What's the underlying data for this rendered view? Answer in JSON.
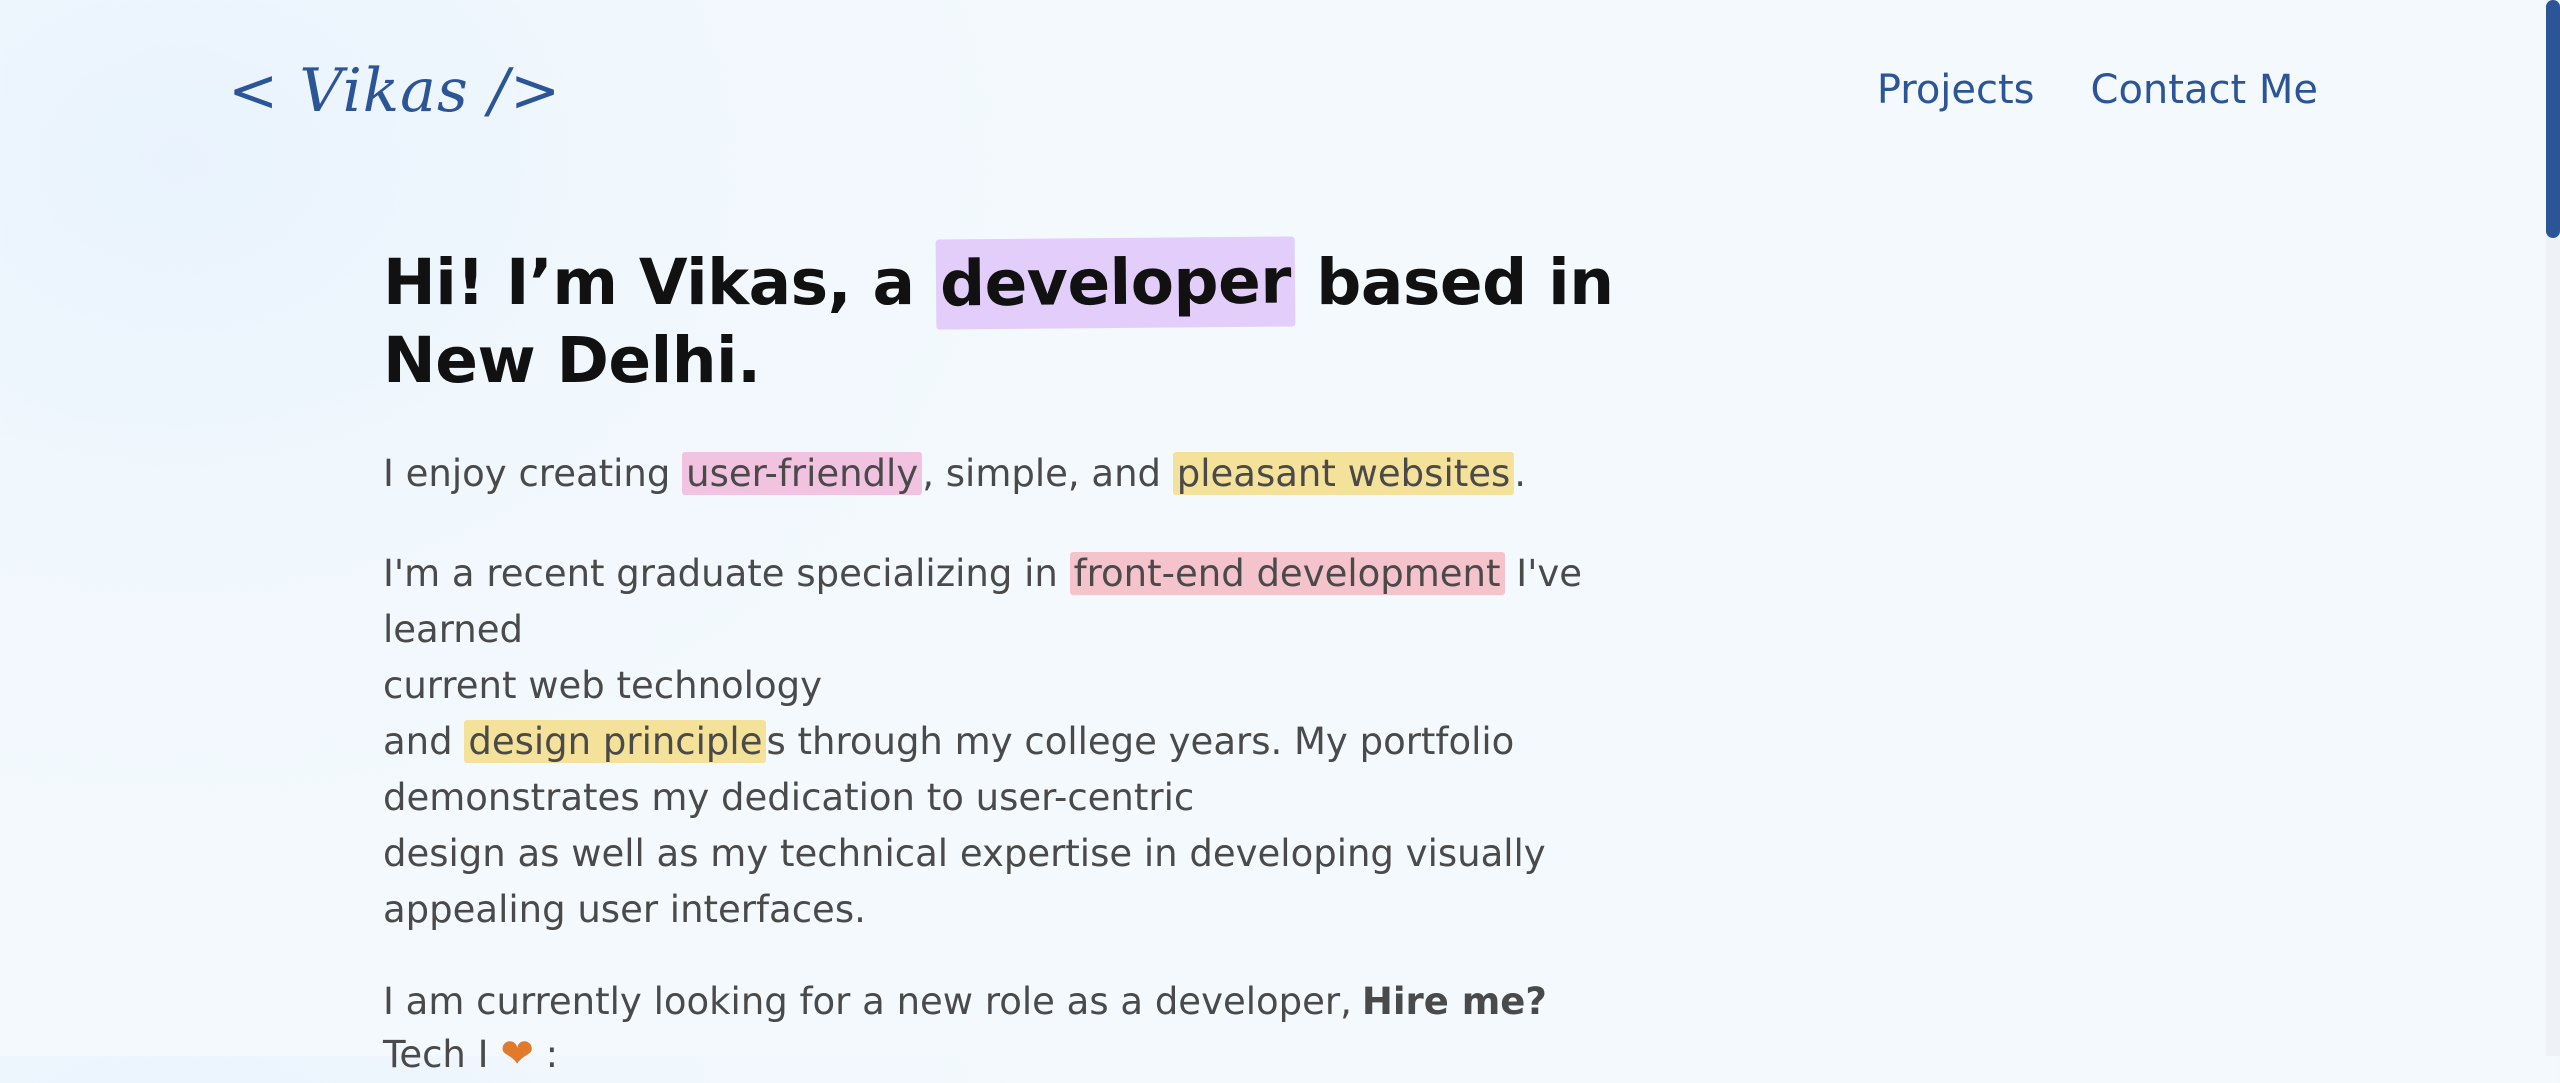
{
  "header": {
    "logo": "< Vikas />",
    "nav": [
      "Projects",
      "Contact Me"
    ]
  },
  "hero": {
    "heading_pre": "Hi! I’m Vikas, a ",
    "heading_hl": "developer",
    "heading_post": " based in",
    "heading_line2": "New Delhi.",
    "p1": {
      "a": "I enjoy creating ",
      "hl1": "user-friendly",
      "b": ", simple, and ",
      "hl2": "pleasant websites",
      "c": "."
    },
    "p2": {
      "a": "I'm a recent graduate specializing in ",
      "hl1": "front-end development",
      "b": " I've learned",
      "line2": "current web technology",
      "c": "and ",
      "hl2": "design principle",
      "d": "s through my college years. My portfolio",
      "line4": "demonstrates my dedication to user-centric",
      "line5": "design as well as my technical expertise in developing visually",
      "line6": "appealing user interfaces."
    },
    "p3": {
      "text": "I am currently looking for a new role as a developer,",
      "hire": "Hire me?"
    },
    "tech": {
      "pre": "Tech I",
      "heart": "❤",
      "post": " :"
    }
  },
  "colors": {
    "accent": "#2b5597",
    "highlight_purple": "#e2cdfb",
    "highlight_pink": "#f2c3e0",
    "highlight_yellow": "#f4e19a",
    "highlight_red": "#f4c3cb",
    "heart": "#e07a2c"
  }
}
